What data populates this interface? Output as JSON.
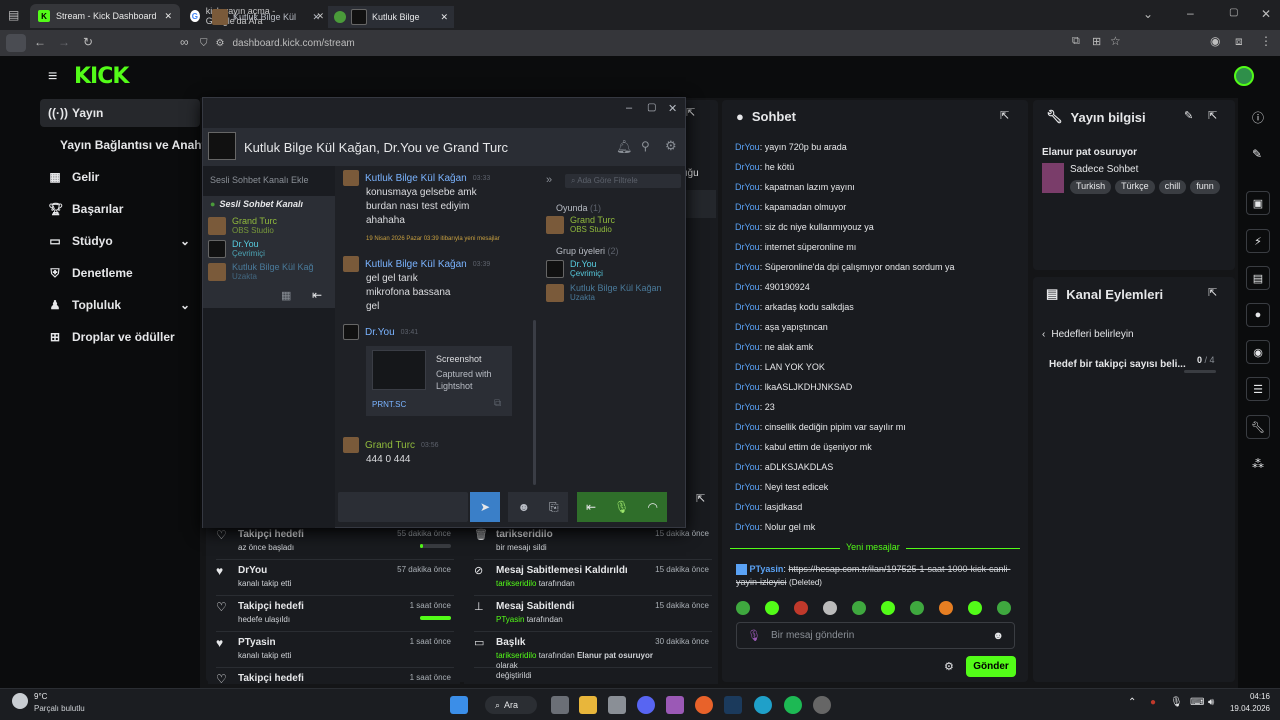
{
  "browser": {
    "tabs": [
      {
        "label": "Stream - Kick Dashboard"
      },
      {
        "label": "kick yayın açma - Google'da Ara"
      }
    ],
    "url": "dashboard.kick.com/stream"
  },
  "sidebar": {
    "items": [
      {
        "label": "Yayın",
        "icon": "broadcast-icon"
      },
      {
        "label": "Yayın Bağlantısı ve Anahtarı",
        "icon": ""
      },
      {
        "label": "Gelir",
        "icon": "revenue-icon"
      },
      {
        "label": "Başarılar",
        "icon": "trophy-icon"
      },
      {
        "label": "Stüdyo",
        "icon": "studio-icon"
      },
      {
        "label": "Denetleme",
        "icon": "shield-icon"
      },
      {
        "label": "Topluluk",
        "icon": "community-icon"
      },
      {
        "label": "Droplar ve ödüller",
        "icon": "gift-icon"
      }
    ]
  },
  "chat": {
    "title": "Sohbet",
    "messages": [
      {
        "user": "DrYou",
        "text": "yayın 720p bu arada"
      },
      {
        "user": "DrYou",
        "text": "he kötü"
      },
      {
        "user": "DrYou",
        "text": "kapatman lazım yayını"
      },
      {
        "user": "DrYou",
        "text": "kapamadan olmuyor"
      },
      {
        "user": "DrYou",
        "text": "siz dc niye kullanmıyouz ya"
      },
      {
        "user": "DrYou",
        "text": "internet süperonline mı"
      },
      {
        "user": "DrYou",
        "text": "Süperonline'da dpi çalışmıyor ondan sordum ya"
      },
      {
        "user": "DrYou",
        "text": "490190924"
      },
      {
        "user": "DrYou",
        "text": "arkadaş kodu salkdjas"
      },
      {
        "user": "DrYou",
        "text": "aşa yapıştıncan"
      },
      {
        "user": "DrYou",
        "text": "ne alak amk"
      },
      {
        "user": "DrYou",
        "text": "LAN YOK YOK"
      },
      {
        "user": "DrYou",
        "text": "lkaASLJKDHJNKSAD"
      },
      {
        "user": "DrYou",
        "text": "23"
      },
      {
        "user": "DrYou",
        "text": "cinsellik dediğin pipim var sayılır mı"
      },
      {
        "user": "DrYou",
        "text": "kabul ettim de üşeniyor mk"
      },
      {
        "user": "DrYou",
        "text": "aDLKSJAKDLAS"
      },
      {
        "user": "DrYou",
        "text": "Neyi test edicek"
      },
      {
        "user": "DrYou",
        "text": "lasjdkasd"
      },
      {
        "user": "DrYou",
        "text": "Nolur gel mk"
      }
    ],
    "new_messages": "Yeni mesajlar",
    "deleted": {
      "user": "PTyasin",
      "link": "https://hesap.com.tr/ilan/197525-1-saat-1000-kick-canli-yayin-izleyici",
      "note": "(Deleted)"
    },
    "input_placeholder": "Bir mesaj gönderin",
    "send_label": "Gönder"
  },
  "stream_info": {
    "title": "Yayın bilgisi",
    "stream_title": "Elanur pat osuruyor",
    "category": "Sadece Sohbet",
    "tags": [
      "Turkish",
      "Türkçe",
      "chill",
      "funn"
    ]
  },
  "channel_actions": {
    "title": "Kanal Eylemleri",
    "back_label": "Hedefleri belirleyin",
    "goal_label": "Hedef bir takipçi sayısı beli...",
    "goal_current": "0",
    "goal_total": "/ 4"
  },
  "activity_left": [
    {
      "title": "Takipçi hedefi",
      "sub": "az önce başladı",
      "time": "55 dakika önce",
      "progress": 0.1,
      "icon": "heart-outline-icon"
    },
    {
      "title": "DrYou",
      "sub": "kanalı takip etti",
      "time": "57 dakika önce",
      "icon": "heart-icon"
    },
    {
      "title": "Takipçi hedefi",
      "sub": "hedefe ulaşıldı",
      "time": "1 saat önce",
      "progress": 1.0,
      "icon": "heart-outline-icon"
    },
    {
      "title": "PTyasin",
      "sub": "kanalı takip etti",
      "time": "1 saat önce",
      "icon": "heart-icon"
    },
    {
      "title": "Takipçi hedefi",
      "sub": "",
      "time": "1 saat önce",
      "icon": "heart-outline-icon"
    }
  ],
  "activity_right": [
    {
      "title": "tarikseridilo",
      "sub": "bir mesajı sildi",
      "time": "15 dakika önce",
      "icon": "trash-icon"
    },
    {
      "title": "Mesaj Sabitlemesi Kaldırıldı",
      "user": "tarikseridilo",
      "sub": "tarafından",
      "time": "15 dakika önce",
      "icon": "unpin-icon"
    },
    {
      "title": "Mesaj Sabitlendi",
      "user": "PTyasin",
      "sub": "tarafından",
      "time": "15 dakika önce",
      "icon": "pin-icon"
    },
    {
      "title": "Başlık",
      "user": "tarikseridilo",
      "sub": "tarafından",
      "bold": "Elanur pat osuruyor",
      "sub2": "olarak",
      "sub3": "değiştirildi",
      "time": "30 dakika önce",
      "icon": "title-icon"
    }
  ],
  "steam": {
    "tabs": [
      "Kutluk Bilge Kül",
      "Kutluk Bilge"
    ],
    "title": "Kutluk Bilge Kül Kağan, Dr.You ve Grand Turc",
    "voice_add": "Sesli Sohbet Kanalı Ekle",
    "voice_channel": "Sesli Sohbet Kanalı",
    "voice_members": [
      {
        "name": "Grand Turc",
        "status": "OBS Studio"
      },
      {
        "name": "Dr.You",
        "status": "Çevrimiçi"
      },
      {
        "name": "Kutluk Bilge Kül Kağ",
        "status": "Uzakta"
      }
    ],
    "messages": [
      {
        "name": "Kutluk Bilge Kül Kağan",
        "time": "03:33",
        "lines": [
          "konusmaya gelsebe amk",
          "burdan nası test ediyim",
          "ahahaha"
        ]
      },
      {
        "divider": "19 Nisan 2026 Pazar 03:39 itibarıyla yeni mesajlar"
      },
      {
        "name": "Kutluk Bilge Kül Kağan",
        "time": "03:39",
        "lines": [
          "gel gel tarık",
          "mikrofona bassana",
          "gel"
        ]
      },
      {
        "name": "Dr.You",
        "time": "03:41",
        "embed": {
          "title": "Screenshot",
          "desc": "Captured with Lightshot",
          "site": "PRNT.SC"
        }
      },
      {
        "name": "Grand Turc",
        "time": "03:56",
        "lines": [
          "444 0 444"
        ]
      }
    ],
    "search_placeholder": "Ada Göre Filtrele",
    "online_label": "Oyunda",
    "online_count": "(1)",
    "online": [
      {
        "name": "Grand Turc",
        "status": "OBS Studio"
      }
    ],
    "group_label": "Grup üyeleri",
    "group_count": "(2)",
    "group": [
      {
        "name": "Dr.You",
        "status": "Çevrimiçi"
      },
      {
        "name": "Kutluk Bilge Kül Kağan",
        "status": "Uzakta"
      }
    ]
  },
  "partial_text": "uğu",
  "taskbar": {
    "weather_temp": "9°C",
    "weather_desc": "Parçalı bulutlu",
    "search": "Ara",
    "time": "04:16",
    "date": "19.04.2026"
  }
}
